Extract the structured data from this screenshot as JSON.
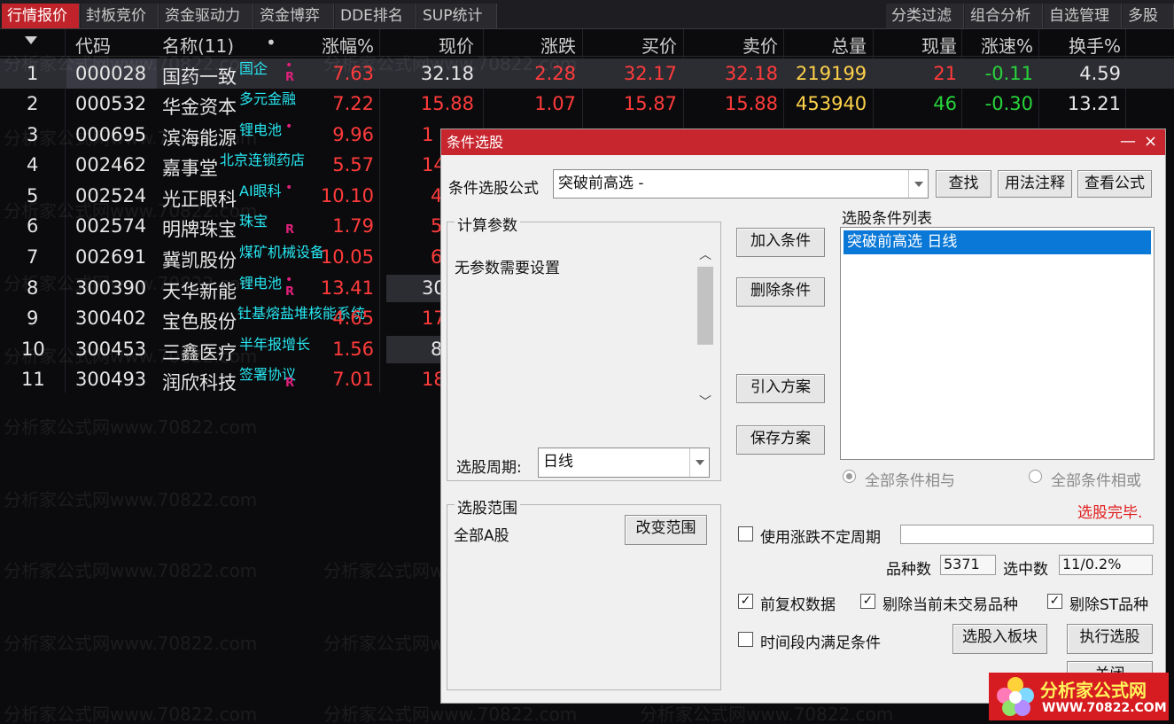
{
  "tabs": [
    "行情报价",
    "封板竞价",
    "资金驱动力",
    "资金博弈",
    "DDE排名",
    "SUP统计"
  ],
  "right_tabs": [
    "分类过滤",
    "组合分析",
    "自选管理",
    "多股"
  ],
  "columns": [
    "代码",
    "名称(11)",
    "•",
    "涨幅%",
    "现价",
    "涨跌",
    "买价",
    "卖价",
    "总量",
    "现量",
    "涨速%",
    "换手%"
  ],
  "rows": [
    {
      "no": "1",
      "code": "000028",
      "name": "国药一致",
      "tag": "国企",
      "pct": "7.63",
      "price": "32.18",
      "chg": "2.28",
      "bid": "32.17",
      "ask": "32.18",
      "vol": "219199",
      "cur": "21",
      "spd": "-0.11",
      "turn": "4.59"
    },
    {
      "no": "2",
      "code": "000532",
      "name": "华金资本",
      "tag": "多元金融",
      "pct": "7.22",
      "price": "15.88",
      "chg": "1.07",
      "bid": "15.87",
      "ask": "15.88",
      "vol": "453940",
      "cur": "46",
      "spd": "-0.30",
      "turn": "13.21"
    },
    {
      "no": "3",
      "code": "000695",
      "name": "滨海能源",
      "tag": "锂电池",
      "pct": "9.96",
      "price": "1"
    },
    {
      "no": "4",
      "code": "002462",
      "name": "嘉事堂",
      "tag": "北京连锁药店",
      "pct": "5.57",
      "price": "14"
    },
    {
      "no": "5",
      "code": "002524",
      "name": "光正眼科",
      "tag": "AI眼科",
      "pct": "10.10",
      "price": "4"
    },
    {
      "no": "6",
      "code": "002574",
      "name": "明牌珠宝",
      "tag": "珠宝",
      "pct": "1.79",
      "price": "5"
    },
    {
      "no": "7",
      "code": "002691",
      "name": "冀凯股份",
      "tag": "煤矿机械设备",
      "pct": "10.05",
      "price": "6"
    },
    {
      "no": "8",
      "code": "300390",
      "name": "天华新能",
      "tag": "锂电池",
      "pct": "13.41",
      "price": "30"
    },
    {
      "no": "9",
      "code": "300402",
      "name": "宝色股份",
      "tag": "钍基熔盐堆核能系统",
      "pct": "4.65",
      "price": "17"
    },
    {
      "no": "10",
      "code": "300453",
      "name": "三鑫医疗",
      "tag": "半年报增长",
      "pct": "1.56",
      "price": "8"
    },
    {
      "no": "11",
      "code": "300493",
      "name": "润欣科技",
      "tag": "签署协议",
      "pct": "7.01",
      "price": "18"
    }
  ],
  "watermark": "分析家公式网www.70822.com",
  "dialog": {
    "title": "条件选股",
    "formula_label": "条件选股公式",
    "formula_value": "突破前高选  -",
    "btn_find": "查找",
    "btn_usage": "用法注释",
    "btn_view": "查看公式",
    "calc_params": "计算参数",
    "no_params": "无参数需要设置",
    "period_label": "选股周期:",
    "period_value": "日线",
    "btn_add": "加入条件",
    "btn_delete": "删除条件",
    "btn_import": "引入方案",
    "btn_save": "保存方案",
    "cond_list_label": "选股条件列表",
    "cond_item": "突破前高选  日线",
    "radio_and": "全部条件相与",
    "radio_or": "全部条件相或",
    "status": "选股完毕.",
    "range_label": "选股范围",
    "range_value": "全部A股",
    "btn_change_range": "改变范围",
    "chk_uncertain": "使用涨跌不定周期",
    "count_label": "品种数",
    "count_value": "5371",
    "selected_label": "选中数",
    "selected_value": "11/0.2%",
    "chk_adjust": "前复权数据",
    "chk_exclude_untraded": "剔除当前未交易品种",
    "chk_exclude_st": "剔除ST品种",
    "chk_time_segment": "时间段内满足条件",
    "btn_to_block": "选股入板块",
    "btn_execute": "执行选股",
    "btn_close": "关闭",
    "check_mark": "✓",
    "close_x": "×",
    "minimize": "—"
  },
  "logo": {
    "name": "分析家公式网",
    "url": "WWW.70822.COM"
  },
  "colors": {
    "up": "#ff3b3b",
    "down": "#28d43c",
    "volume": "#ffd24a",
    "accent": "#c0232a",
    "concept": "#27e6f0"
  }
}
